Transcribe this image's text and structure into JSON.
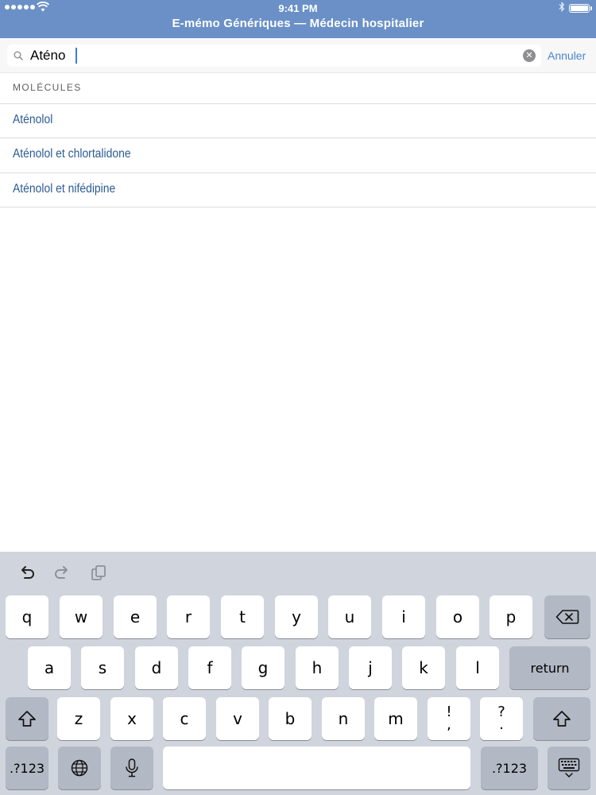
{
  "status_bar": {
    "time": "9:41 PM",
    "battery_level": 1.0
  },
  "header": {
    "title": "E-mémo Génériques — Médecin hospitalier"
  },
  "search": {
    "value": "Aténo",
    "cancel_label": "Annuler"
  },
  "results": {
    "section_title": "MOLÉCULES",
    "items": [
      "Aténolol",
      "Aténolol et chlortalidone",
      "Aténolol et nifédipine"
    ]
  },
  "keyboard": {
    "row1": [
      "q",
      "w",
      "e",
      "r",
      "t",
      "y",
      "u",
      "i",
      "o",
      "p"
    ],
    "row2": [
      "a",
      "s",
      "d",
      "f",
      "g",
      "h",
      "j",
      "k",
      "l"
    ],
    "row3": [
      "z",
      "x",
      "c",
      "v",
      "b",
      "n",
      "m"
    ],
    "punct_1": [
      "!",
      ","
    ],
    "punct_2": [
      "?",
      "."
    ],
    "return_label": "return",
    "numbers_label": ".?123"
  },
  "icons": {
    "search": "search-icon",
    "clear": "clear-icon",
    "undo": "undo-icon",
    "redo": "redo-icon",
    "paste": "paste-icon",
    "delete": "backspace-icon",
    "shift": "shift-icon",
    "globe": "globe-icon",
    "mic": "microphone-icon",
    "dismiss": "keyboard-dismiss-icon"
  },
  "colors": {
    "header": "#6a90c7",
    "link": "#4b84d0",
    "result_text": "#2b5a94",
    "keyboard_bg": "#cfd4dd"
  }
}
